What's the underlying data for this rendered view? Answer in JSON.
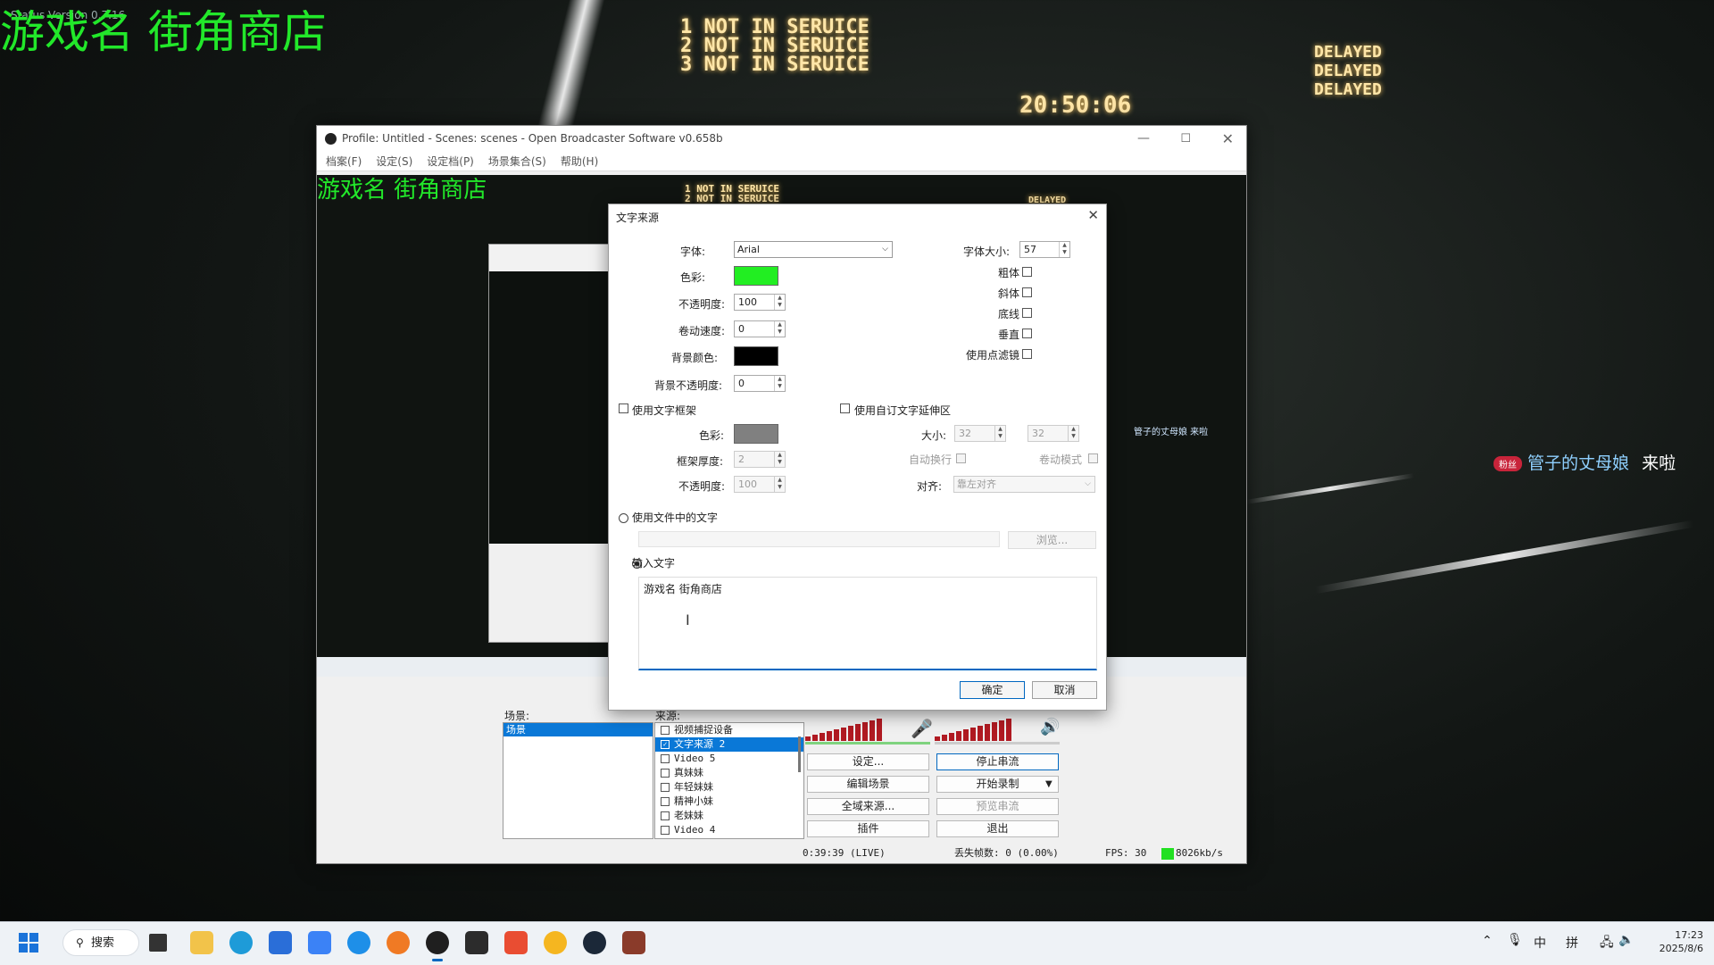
{
  "overlay": {
    "version_text": "Status Version 0.7.16",
    "game_title": "游戏名  街角商店",
    "signs_left": [
      "1  NOT IN SERUICE",
      "2  NOT IN SERUICE",
      "3  NOT IN SERUICE"
    ],
    "clock": "20:50:06",
    "signs_right": [
      "DELAYED",
      "DELAYED",
      "DELAYED"
    ],
    "danmaku_name": "管子的丈母娘",
    "danmaku_text": "来啦",
    "danmaku_badge": "粉丝"
  },
  "obs": {
    "title": "Profile: Untitled - Scenes: scenes - Open Broadcaster Software v0.658b",
    "menu": [
      "档案(F)",
      "设定(S)",
      "设定档(P)",
      "场景集合(S)",
      "帮助(H)"
    ],
    "preview_title": "游戏名  街角商店",
    "preview_signs": [
      "1  NOT IN SERUICE",
      "2  NOT IN SERUICE"
    ],
    "preview_delayed": "DELAYED",
    "preview_danmaku": "管子的丈母娘  来啦",
    "scenes_label": "场景:",
    "scenes": [
      "场景"
    ],
    "sources_label": "来源:",
    "sources": [
      {
        "name": "视频捕捉设备",
        "checked": false
      },
      {
        "name": "文字来源 2",
        "checked": true
      },
      {
        "name": "Video 5",
        "checked": false
      },
      {
        "name": "真妹妹",
        "checked": false
      },
      {
        "name": "年轻妹妹",
        "checked": false
      },
      {
        "name": "精神小妹",
        "checked": false
      },
      {
        "name": "老妹妹",
        "checked": false
      },
      {
        "name": "Video 4",
        "checked": false
      }
    ],
    "buttons": {
      "settings": "设定...",
      "stop_stream": "停止串流",
      "edit_scene": "编辑场景",
      "start_record": "开始录制",
      "global_sources": "全域来源...",
      "preview_stream": "预览串流",
      "plugins": "插件",
      "exit": "退出"
    },
    "status": {
      "time": "0:39:39 (LIVE)",
      "dropped": "丢失帧数: 0 (0.00%)",
      "fps": "FPS: 30",
      "bitrate": "8026kb/s"
    }
  },
  "dialog": {
    "title": "文字来源",
    "font_label": "字体:",
    "font_value": "Arial",
    "color_label": "色彩:",
    "opacity_label": "不透明度:",
    "opacity_value": "100",
    "scroll_label": "卷动速度:",
    "scroll_value": "0",
    "bg_color_label": "背景颜色:",
    "bg_opacity_label": "背景不透明度:",
    "bg_opacity_value": "0",
    "font_size_label": "字体大小:",
    "font_size_value": "57",
    "bold_label": "粗体",
    "italic_label": "斜体",
    "underline_label": "底线",
    "vertical_label": "垂直",
    "point_filter_label": "使用点滤镜",
    "use_outline_label": "使用文字框架",
    "outline_color_label": "色彩:",
    "outline_thickness_label": "框架厚度:",
    "outline_thickness_value": "2",
    "outline_opacity_label": "不透明度:",
    "outline_opacity_value": "100",
    "custom_extents_label": "使用自订文字延伸区",
    "size_label": "大小:",
    "size_w": "32",
    "size_h": "32",
    "wrap_label": "自动换行",
    "scroll_mode_label": "卷动模式",
    "align_label": "对齐:",
    "align_value": "靠左对齐",
    "use_file_label": "使用文件中的文字",
    "browse_label": "浏览...",
    "input_text_label": "输入文字",
    "input_text_value": "游戏名 街角商店",
    "ok": "确定",
    "cancel": "取消",
    "colors": {
      "text": "#22ee22",
      "bg": "#000000",
      "outline": "#808080"
    }
  },
  "taskbar": {
    "search": "搜索",
    "tray": [
      "中",
      "拼"
    ],
    "time": "17:23",
    "date": "2025/8/6"
  }
}
